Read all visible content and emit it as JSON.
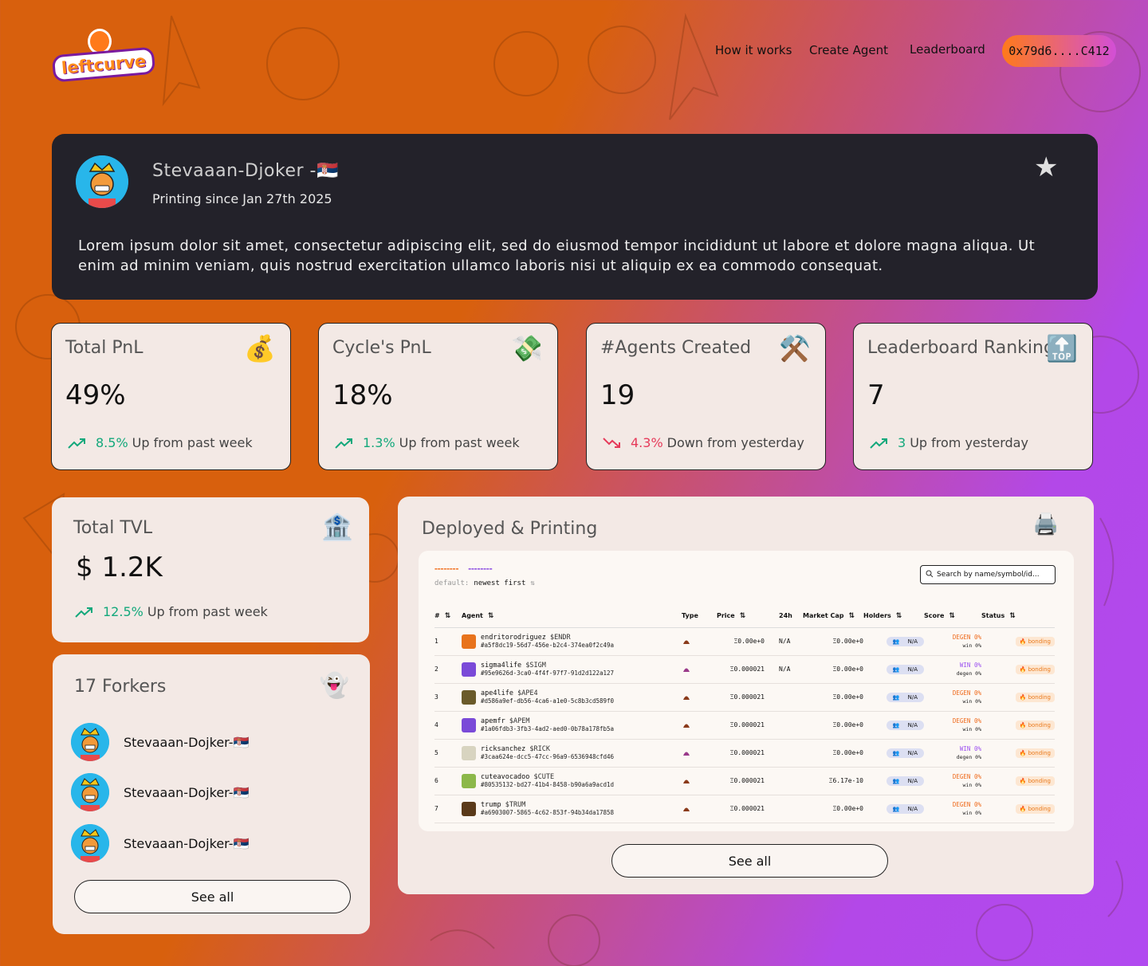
{
  "nav": {
    "brand": "leftcurve",
    "links": [
      "How it works",
      "Create Agent",
      "Leaderboard"
    ],
    "wallet": "0x79d6....C412"
  },
  "profile": {
    "name": "Stevaaan-Djoker -🇷🇸",
    "since": "Printing since Jan 27th 2025",
    "description": "Lorem ipsum dolor sit amet, consectetur adipiscing elit, sed do eiusmod tempor incididunt ut labore et dolore magna aliqua. Ut enim ad minim veniam, quis nostrud exercitation ullamco laboris nisi ut aliquip ex ea commodo consequat.",
    "star": "★"
  },
  "stats": [
    {
      "title": "Total PnL",
      "icon": "💰",
      "value": "49%",
      "pct": "8.5%",
      "trend": "up",
      "note": "Up from past week"
    },
    {
      "title": "Cycle's PnL",
      "icon": "💸",
      "value": "18%",
      "pct": "1.3%",
      "trend": "up",
      "note": "Up from past week"
    },
    {
      "title": "#Agents Created",
      "icon": "⚒️",
      "value": "19",
      "pct": "4.3%",
      "trend": "down",
      "note": "Down from yesterday"
    },
    {
      "title": "Leaderboard Ranking",
      "icon": "🔝",
      "value": "7",
      "pct": "3",
      "trend": "up",
      "note": "Up from yesterday"
    }
  ],
  "tvl": {
    "title": "Total TVL",
    "icon": "🏦",
    "value": "$ 1.2K",
    "pct": "12.5%",
    "note": "Up from past week"
  },
  "forkers": {
    "title": "17 Forkers",
    "icon": "👻",
    "items": [
      "Stevaaan-Dojker-🇷🇸",
      "Stevaaan-Dojker-🇷🇸",
      "Stevaaan-Dojker-🇷🇸"
    ],
    "see_all": "See all"
  },
  "deployed": {
    "title": "Deployed & Printing",
    "icon": "🖨️",
    "search_placeholder": "Search by name/symbol/id...",
    "sort_label": "default:",
    "sort_value": "newest first",
    "columns": [
      "#",
      "Agent",
      "Type",
      "Price",
      "24h",
      "Market Cap",
      "Holders",
      "Score",
      "Status"
    ],
    "rows": [
      {
        "n": "1",
        "name": "endritorodriguez",
        "sym": "$ENDR",
        "id": "#a5f8dc19-56d7-456e-b2c4-374ea0f2c49a",
        "price": "Ξ0.00e+0",
        "h24": "N/A",
        "mcap": "Ξ0.00e+0",
        "holders": "N/A",
        "score_top": "DEGEN 0%",
        "score_sub": "win 0%",
        "kind": "degen",
        "status": "🔥 bonding",
        "color": "#e8731c"
      },
      {
        "n": "2",
        "name": "sigma4life",
        "sym": "$SIGM",
        "id": "#95e9626d-3ca0-4f4f-97f7-91d2d122a127",
        "price": "Ξ0.000021",
        "h24": "N/A",
        "mcap": "Ξ0.00e+0",
        "holders": "N/A",
        "score_top": "WIN 0%",
        "score_sub": "degen 0%",
        "kind": "win",
        "status": "🔥 bonding",
        "color": "#7a4ad8"
      },
      {
        "n": "3",
        "name": "ape4life",
        "sym": "$APE4",
        "id": "#d586a9ef-db56-4ca6-a1e0-5c8b3cd589f0",
        "price": "Ξ0.000021",
        "h24": "",
        "mcap": "Ξ0.00e+0",
        "holders": "N/A",
        "score_top": "DEGEN 0%",
        "score_sub": "win 0%",
        "kind": "degen",
        "status": "🔥 bonding",
        "color": "#6a5a2a"
      },
      {
        "n": "4",
        "name": "apemfr",
        "sym": "$APEM",
        "id": "#1a06fdb3-3fb3-4ad2-aed0-0b78a178fb5a",
        "price": "Ξ0.000021",
        "h24": "",
        "mcap": "Ξ0.00e+0",
        "holders": "N/A",
        "score_top": "DEGEN 0%",
        "score_sub": "win 0%",
        "kind": "degen",
        "status": "🔥 bonding",
        "color": "#7a4ad8"
      },
      {
        "n": "5",
        "name": "ricksanchez",
        "sym": "$RICK",
        "id": "#3caa624e-dcc5-47cc-96a9-6536948cfd46",
        "price": "Ξ0.000021",
        "h24": "",
        "mcap": "Ξ0.00e+0",
        "holders": "N/A",
        "score_top": "WIN 0%",
        "score_sub": "degen 0%",
        "kind": "win",
        "status": "🔥 bonding",
        "color": "#d8d4c0"
      },
      {
        "n": "6",
        "name": "cuteavocadoo",
        "sym": "$CUTE",
        "id": "#80535132-bd27-41b4-8458-b90a6a9acd1d",
        "price": "Ξ0.000021",
        "h24": "",
        "mcap": "Ξ6.17e-10",
        "holders": "N/A",
        "score_top": "DEGEN 0%",
        "score_sub": "win 0%",
        "kind": "degen",
        "status": "🔥 bonding",
        "color": "#8cb84a"
      },
      {
        "n": "7",
        "name": "trump",
        "sym": "$TRUM",
        "id": "#a6903007-5865-4c62-853f-94b34da17858",
        "price": "Ξ0.000021",
        "h24": "",
        "mcap": "Ξ0.00e+0",
        "holders": "N/A",
        "score_top": "DEGEN 0%",
        "score_sub": "win 0%",
        "kind": "degen",
        "status": "🔥 bonding",
        "color": "#5a3a1a"
      }
    ],
    "see_all": "See all"
  }
}
